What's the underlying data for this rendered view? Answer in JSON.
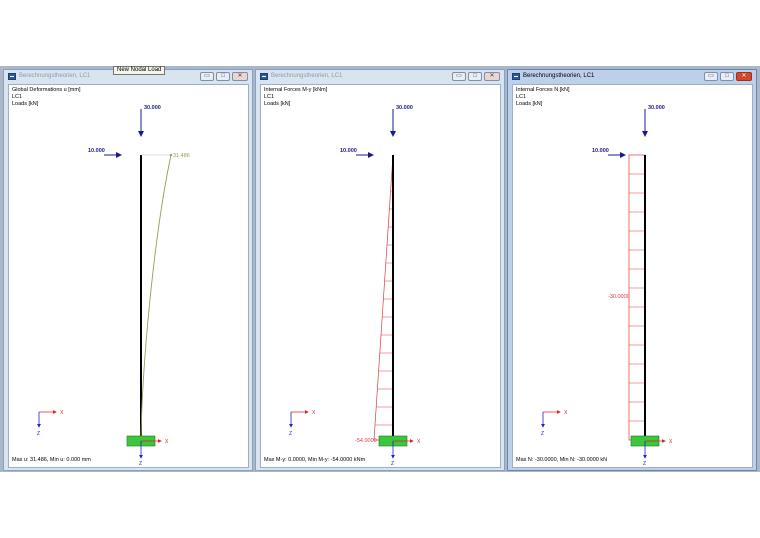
{
  "tooltip": "New Nodal Load",
  "controls": {
    "minimize": "▭",
    "maximize": "□",
    "close": "✕"
  },
  "windows": [
    {
      "title": "Berechnungstheorien, LC1",
      "info": [
        "Global Deformations u [mm]",
        "LC1",
        "Loads [kN]"
      ],
      "load_top": "30.000",
      "load_side": "10.000",
      "result_label": "31.486",
      "footer": "Max u: 31.486, Min u: 0.000 mm",
      "axis_x": "X",
      "axis_z": "Z"
    },
    {
      "title": "Berechnungstheorien, LC1",
      "info": [
        "Internal Forces M-y [kNm]",
        "LC1",
        "Loads [kN]"
      ],
      "load_top": "30.000",
      "load_side": "10.000",
      "result_label": "-54.0000",
      "footer": "Max M-y: 0.0000, Min M-y: -54.0000 kNm",
      "axis_x": "X",
      "axis_z": "Z"
    },
    {
      "title": "Berechnungstheorien, LC1",
      "info": [
        "Internal Forces N [kN]",
        "LC1",
        "Loads [kN]"
      ],
      "load_top": "30.000",
      "load_side": "10.000",
      "result_label": "-30.0000",
      "footer": "Max N: -30.0000, Min N: -30.0000 kN",
      "axis_x": "X",
      "axis_z": "Z"
    }
  ],
  "colors": {
    "load": "#1a1a8c",
    "deformation": "#9a9a55",
    "moment": "#e23b3b",
    "normal": "#e23b3b",
    "support": "#3cc63c",
    "axis_x": "#e02020",
    "axis_z": "#2020d0"
  }
}
